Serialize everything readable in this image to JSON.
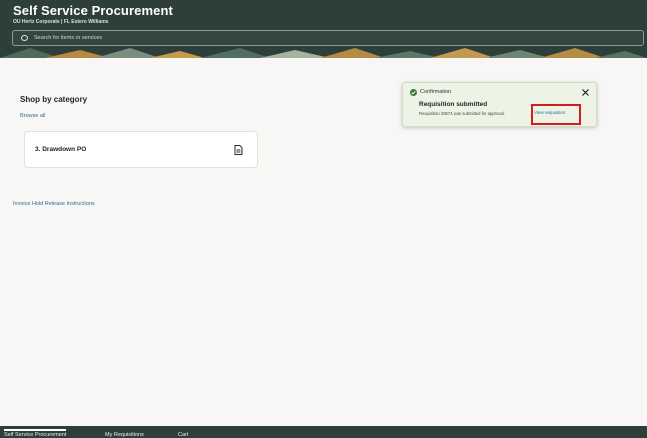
{
  "header": {
    "title": "Self Service Procurement",
    "subtitle": "OU Hertz Corporate | FL Estero Williams",
    "search_placeholder": "Search for items or services"
  },
  "main": {
    "section_title": "Shop by category",
    "browse_all": "Browse all",
    "category_card": {
      "label": "3. Drawdown PO",
      "icon": "document-icon"
    },
    "invoice_link": "Invoice Hold Release Instructions"
  },
  "toast": {
    "type": "Confirmation",
    "title": "Requisition submitted",
    "message": "Requisition 28574 was submitted for approval.",
    "link": "View requisition",
    "colors": {
      "background": "#edf4e6",
      "success": "#3b7a32",
      "highlight": "#d41c1c"
    }
  },
  "footer": {
    "tabs": [
      "Self Service Procurement",
      "My Requisitions",
      "Cart"
    ]
  },
  "colors": {
    "header_bg": "#2e3f3b",
    "link": "#2f6c8e",
    "page_bg": "#f8f7f5"
  }
}
